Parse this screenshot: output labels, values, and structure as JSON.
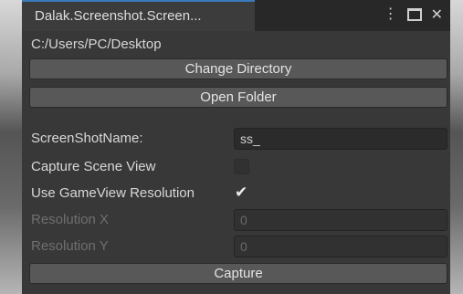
{
  "window": {
    "tab_title": "Dalak.Screenshot.Screen...",
    "controls": {
      "more": "⋮",
      "maximize": "maximize-icon",
      "close": "✕"
    }
  },
  "path": "C:/Users/PC/Desktop",
  "buttons": {
    "change_directory": "Change Directory",
    "open_folder": "Open Folder",
    "capture": "Capture"
  },
  "fields": {
    "screenshot_name": {
      "label": "ScreenShotName:",
      "value": "ss_"
    },
    "capture_scene_view": {
      "label": "Capture Scene View",
      "checked": false
    },
    "use_gameview_resolution": {
      "label": "Use GameView Resolution",
      "checked": true
    },
    "resolution_x": {
      "label": "Resolution X",
      "value": "0"
    },
    "resolution_y": {
      "label": "Resolution Y",
      "value": "0"
    }
  },
  "colors": {
    "accent": "#3a79bb",
    "panel": "#383838",
    "button": "#585858"
  }
}
